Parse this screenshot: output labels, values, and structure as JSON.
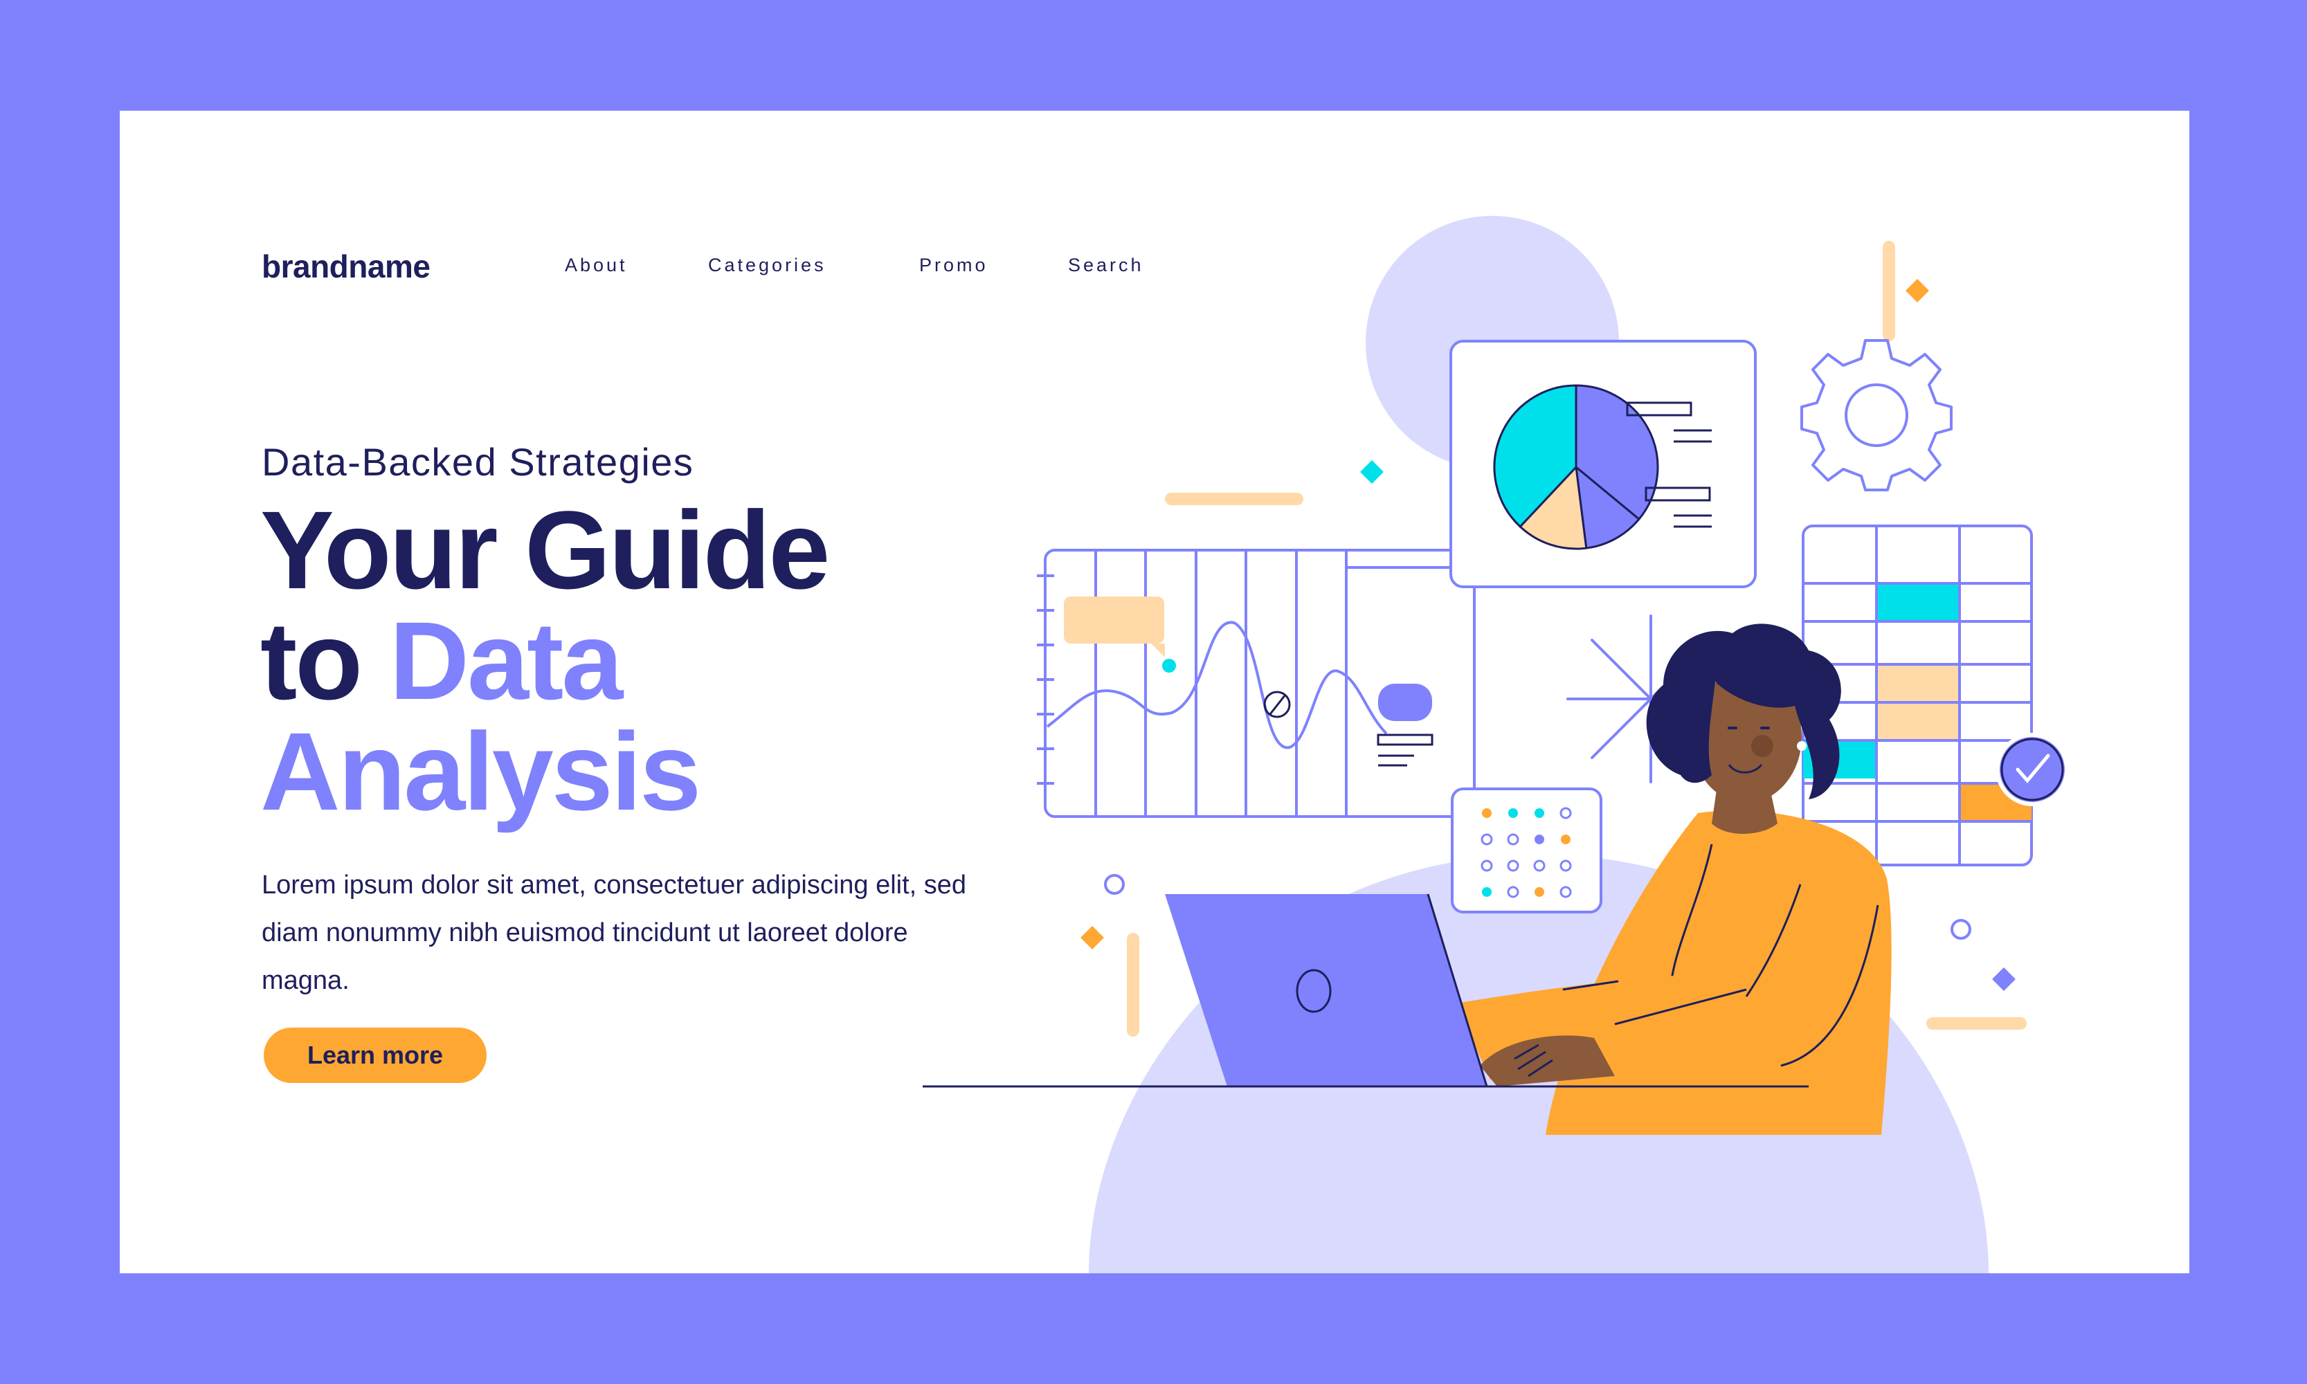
{
  "header": {
    "brand": "brandname",
    "nav": [
      "About",
      "Categories",
      "Promo",
      "Search"
    ]
  },
  "hero": {
    "subtitle": "Data-Backed Strategies",
    "headline_line1": "Your Guide",
    "headline_to": "to",
    "headline_data": "Data",
    "headline_analysis": "Analysis",
    "body": "Lorem ipsum dolor sit amet, consectetuer adipiscing elit, sed diam nonummy nibh euismod tincidunt ut laoreet dolore magna.",
    "cta_label": "Learn more"
  },
  "colors": {
    "frame": "#7f82fc",
    "navy": "#1e1f5c",
    "accent": "#7f82fc",
    "orange": "#ffa733",
    "cyan": "#00e0ea",
    "peach": "#ffd9a8",
    "lavender": "#d9dafd"
  },
  "illustration": {
    "pie_slices": [
      0.36,
      0.12,
      0.14,
      0.38
    ]
  }
}
